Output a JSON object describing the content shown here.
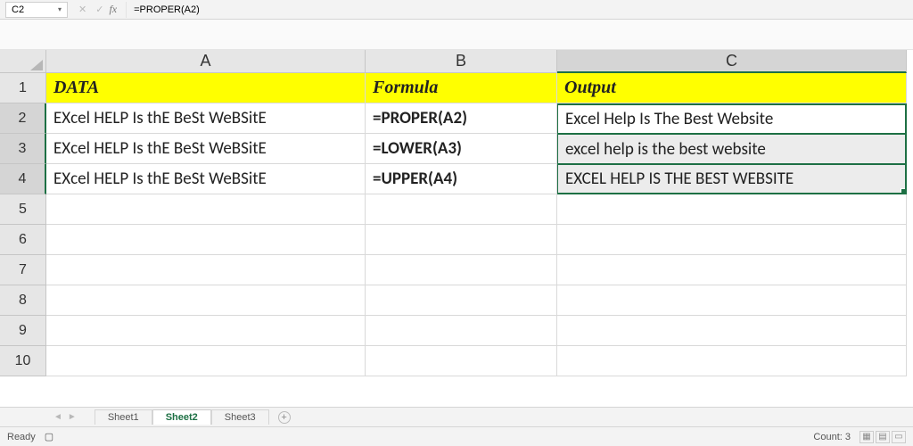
{
  "formula_bar": {
    "cell_ref": "C2",
    "formula": "=PROPER(A2)"
  },
  "columns": {
    "A": "A",
    "B": "B",
    "C": "C"
  },
  "rows": [
    "1",
    "2",
    "3",
    "4",
    "5",
    "6",
    "7",
    "8",
    "9",
    "10"
  ],
  "headers": {
    "A": "DATA",
    "B": "Formula",
    "C": "Output"
  },
  "r2": {
    "A": "EXcel HELP Is thE BeSt WeBSitE",
    "B": "=PROPER(A2)",
    "C": "Excel Help Is The Best Website"
  },
  "r3": {
    "A": "EXcel HELP Is thE BeSt WeBSitE",
    "B": "=LOWER(A3)",
    "C": "excel help is the best website"
  },
  "r4": {
    "A": "EXcel HELP Is thE BeSt WeBSitE",
    "B": "=UPPER(A4)",
    "C": "EXCEL HELP IS THE BEST WEBSITE"
  },
  "sheets": {
    "s1": "Sheet1",
    "s2": "Sheet2",
    "s3": "Sheet3"
  },
  "status": {
    "ready": "Ready",
    "count_label": "Count: 3"
  }
}
